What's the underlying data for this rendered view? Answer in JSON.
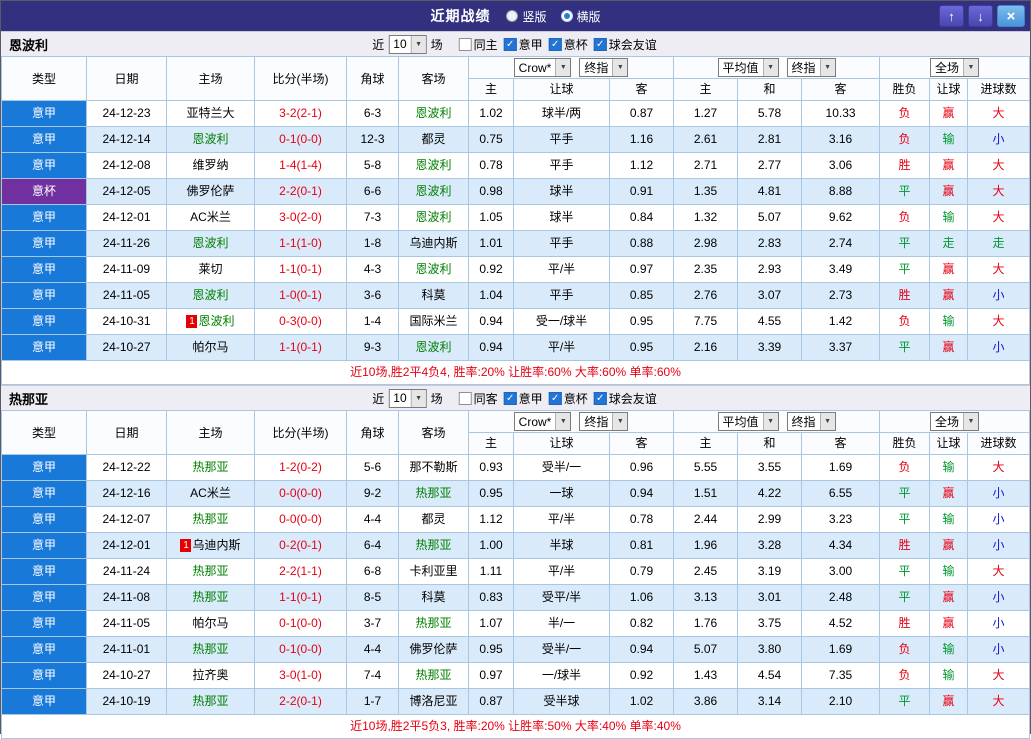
{
  "titlebar": {
    "title": "近期战绩",
    "layout_options": [
      {
        "label": "竖版",
        "selected": false
      },
      {
        "label": "横版",
        "selected": true
      }
    ]
  },
  "icons": {
    "dropdown": "▼",
    "check": "✓",
    "up": "↑",
    "down": "↓",
    "close": "×"
  },
  "colors": {
    "titlebar_bg": "#33307F",
    "serie_a_bg": "#1879D9",
    "coppa_italia_bg": "#7030A0",
    "featured_team_text": "#008000",
    "score_text": "#E60012",
    "alt_row_bg": "#D9EAFB",
    "summary_text": "#E60012"
  },
  "result_colors": {
    "胜": "red",
    "平": "green",
    "负": "red",
    "赢": "red",
    "输": "green",
    "走": "green",
    "大": "red",
    "小": "blue"
  },
  "table_header": {
    "type": "类型",
    "date": "日期",
    "home": "主场",
    "score": "比分(半场)",
    "corner": "角球",
    "away": "客场",
    "odds_select": "Crow*",
    "odds_time_select": "终指",
    "odds_home": "主",
    "odds_handicap": "让球",
    "odds_away": "客",
    "avg_select": "平均值",
    "avg_time_select": "终指",
    "avg_home": "主",
    "avg_draw": "和",
    "avg_away": "客",
    "period_select": "全场",
    "result": "胜负",
    "result_handicap": "让球",
    "result_goals": "进球数"
  },
  "sections": [
    {
      "team": "恩波利",
      "filter": {
        "near_label": "近",
        "count": "10",
        "games_label": "场",
        "checks": [
          {
            "label": "同主",
            "checked": false
          },
          {
            "label": "意甲",
            "checked": true
          },
          {
            "label": "意杯",
            "checked": true
          },
          {
            "label": "球会友谊",
            "checked": true
          }
        ]
      },
      "rows": [
        {
          "league": "意甲",
          "date": "24-12-23",
          "home": "亚特兰大",
          "score": "3-2(2-1)",
          "corner": "6-3",
          "away": "恩波利",
          "away_feat": true,
          "o1": "1.02",
          "hc": "球半/两",
          "o2": "0.87",
          "avg_h": "1.27",
          "avg_d": "5.78",
          "avg_a": "10.33",
          "result": "负",
          "handicap_result": "赢",
          "goals_result": "大"
        },
        {
          "league": "意甲",
          "date": "24-12-14",
          "home": "恩波利",
          "home_feat": true,
          "score": "0-1(0-0)",
          "corner": "12-3",
          "away": "都灵",
          "o1": "0.75",
          "hc": "平手",
          "o2": "1.16",
          "avg_h": "2.61",
          "avg_d": "2.81",
          "avg_a": "3.16",
          "result": "负",
          "handicap_result": "输",
          "goals_result": "小"
        },
        {
          "league": "意甲",
          "date": "24-12-08",
          "home": "维罗纳",
          "score": "1-4(1-4)",
          "corner": "5-8",
          "away": "恩波利",
          "away_feat": true,
          "o1": "0.78",
          "hc": "平手",
          "o2": "1.12",
          "avg_h": "2.71",
          "avg_d": "2.77",
          "avg_a": "3.06",
          "result": "胜",
          "handicap_result": "赢",
          "goals_result": "大"
        },
        {
          "league": "意杯",
          "date": "24-12-05",
          "home": "佛罗伦萨",
          "score": "2-2(0-1)",
          "corner": "6-6",
          "away": "恩波利",
          "away_feat": true,
          "o1": "0.98",
          "hc": "球半",
          "o2": "0.91",
          "avg_h": "1.35",
          "avg_d": "4.81",
          "avg_a": "8.88",
          "result": "平",
          "handicap_result": "赢",
          "goals_result": "大"
        },
        {
          "league": "意甲",
          "date": "24-12-01",
          "home": "AC米兰",
          "score": "3-0(2-0)",
          "corner": "7-3",
          "away": "恩波利",
          "away_feat": true,
          "o1": "1.05",
          "hc": "球半",
          "o2": "0.84",
          "avg_h": "1.32",
          "avg_d": "5.07",
          "avg_a": "9.62",
          "result": "负",
          "handicap_result": "输",
          "goals_result": "大"
        },
        {
          "league": "意甲",
          "date": "24-11-26",
          "home": "恩波利",
          "home_feat": true,
          "score": "1-1(1-0)",
          "corner": "1-8",
          "away": "乌迪内斯",
          "o1": "1.01",
          "hc": "平手",
          "o2": "0.88",
          "avg_h": "2.98",
          "avg_d": "2.83",
          "avg_a": "2.74",
          "result": "平",
          "handicap_result": "走",
          "goals_result": "走"
        },
        {
          "league": "意甲",
          "date": "24-11-09",
          "home": "莱切",
          "score": "1-1(0-1)",
          "corner": "4-3",
          "away": "恩波利",
          "away_feat": true,
          "o1": "0.92",
          "hc": "平/半",
          "o2": "0.97",
          "avg_h": "2.35",
          "avg_d": "2.93",
          "avg_a": "3.49",
          "result": "平",
          "handicap_result": "赢",
          "goals_result": "大"
        },
        {
          "league": "意甲",
          "date": "24-11-05",
          "home": "恩波利",
          "home_feat": true,
          "score": "1-0(0-1)",
          "corner": "3-6",
          "away": "科莫",
          "o1": "1.04",
          "hc": "平手",
          "o2": "0.85",
          "avg_h": "2.76",
          "avg_d": "3.07",
          "avg_a": "2.73",
          "result": "胜",
          "handicap_result": "赢",
          "goals_result": "小"
        },
        {
          "league": "意甲",
          "date": "24-10-31",
          "home": "恩波利",
          "home_feat": true,
          "home_card": "1",
          "score": "0-3(0-0)",
          "corner": "1-4",
          "away": "国际米兰",
          "o1": "0.94",
          "hc": "受一/球半",
          "o2": "0.95",
          "avg_h": "7.75",
          "avg_d": "4.55",
          "avg_a": "1.42",
          "result": "负",
          "handicap_result": "输",
          "goals_result": "大"
        },
        {
          "league": "意甲",
          "date": "24-10-27",
          "home": "帕尔马",
          "score": "1-1(0-1)",
          "corner": "9-3",
          "away": "恩波利",
          "away_feat": true,
          "o1": "0.94",
          "hc": "平/半",
          "o2": "0.95",
          "avg_h": "2.16",
          "avg_d": "3.39",
          "avg_a": "3.37",
          "result": "平",
          "handicap_result": "赢",
          "goals_result": "小"
        }
      ],
      "summary": "近10场,胜2平4负4, 胜率:20% 让胜率:60% 大率:60% 单率:60%"
    },
    {
      "team": "热那亚",
      "filter": {
        "near_label": "近",
        "count": "10",
        "games_label": "场",
        "checks": [
          {
            "label": "同客",
            "checked": false
          },
          {
            "label": "意甲",
            "checked": true
          },
          {
            "label": "意杯",
            "checked": true
          },
          {
            "label": "球会友谊",
            "checked": true
          }
        ]
      },
      "rows": [
        {
          "league": "意甲",
          "date": "24-12-22",
          "home": "热那亚",
          "home_feat": true,
          "score": "1-2(0-2)",
          "corner": "5-6",
          "away": "那不勒斯",
          "o1": "0.93",
          "hc": "受半/一",
          "o2": "0.96",
          "avg_h": "5.55",
          "avg_d": "3.55",
          "avg_a": "1.69",
          "result": "负",
          "handicap_result": "输",
          "goals_result": "大"
        },
        {
          "league": "意甲",
          "date": "24-12-16",
          "home": "AC米兰",
          "score": "0-0(0-0)",
          "corner": "9-2",
          "away": "热那亚",
          "away_feat": true,
          "o1": "0.95",
          "hc": "一球",
          "o2": "0.94",
          "avg_h": "1.51",
          "avg_d": "4.22",
          "avg_a": "6.55",
          "result": "平",
          "handicap_result": "赢",
          "goals_result": "小"
        },
        {
          "league": "意甲",
          "date": "24-12-07",
          "home": "热那亚",
          "home_feat": true,
          "score": "0-0(0-0)",
          "corner": "4-4",
          "away": "都灵",
          "o1": "1.12",
          "hc": "平/半",
          "o2": "0.78",
          "avg_h": "2.44",
          "avg_d": "2.99",
          "avg_a": "3.23",
          "result": "平",
          "handicap_result": "输",
          "goals_result": "小"
        },
        {
          "league": "意甲",
          "date": "24-12-01",
          "home": "乌迪内斯",
          "home_card": "1",
          "score": "0-2(0-1)",
          "corner": "6-4",
          "away": "热那亚",
          "away_feat": true,
          "o1": "1.00",
          "hc": "半球",
          "o2": "0.81",
          "avg_h": "1.96",
          "avg_d": "3.28",
          "avg_a": "4.34",
          "result": "胜",
          "handicap_result": "赢",
          "goals_result": "小"
        },
        {
          "league": "意甲",
          "date": "24-11-24",
          "home": "热那亚",
          "home_feat": true,
          "score": "2-2(1-1)",
          "corner": "6-8",
          "away": "卡利亚里",
          "o1": "1.11",
          "hc": "平/半",
          "o2": "0.79",
          "avg_h": "2.45",
          "avg_d": "3.19",
          "avg_a": "3.00",
          "result": "平",
          "handicap_result": "输",
          "goals_result": "大"
        },
        {
          "league": "意甲",
          "date": "24-11-08",
          "home": "热那亚",
          "home_feat": true,
          "score": "1-1(0-1)",
          "corner": "8-5",
          "away": "科莫",
          "o1": "0.83",
          "hc": "受平/半",
          "o2": "1.06",
          "avg_h": "3.13",
          "avg_d": "3.01",
          "avg_a": "2.48",
          "result": "平",
          "handicap_result": "赢",
          "goals_result": "小"
        },
        {
          "league": "意甲",
          "date": "24-11-05",
          "home": "帕尔马",
          "score": "0-1(0-0)",
          "corner": "3-7",
          "away": "热那亚",
          "away_feat": true,
          "o1": "1.07",
          "hc": "半/一",
          "o2": "0.82",
          "avg_h": "1.76",
          "avg_d": "3.75",
          "avg_a": "4.52",
          "result": "胜",
          "handicap_result": "赢",
          "goals_result": "小"
        },
        {
          "league": "意甲",
          "date": "24-11-01",
          "home": "热那亚",
          "home_feat": true,
          "score": "0-1(0-0)",
          "corner": "4-4",
          "away": "佛罗伦萨",
          "o1": "0.95",
          "hc": "受半/一",
          "o2": "0.94",
          "avg_h": "5.07",
          "avg_d": "3.80",
          "avg_a": "1.69",
          "result": "负",
          "handicap_result": "输",
          "goals_result": "小"
        },
        {
          "league": "意甲",
          "date": "24-10-27",
          "home": "拉齐奥",
          "score": "3-0(1-0)",
          "corner": "7-4",
          "away": "热那亚",
          "away_feat": true,
          "o1": "0.97",
          "hc": "一/球半",
          "o2": "0.92",
          "avg_h": "1.43",
          "avg_d": "4.54",
          "avg_a": "7.35",
          "result": "负",
          "handicap_result": "输",
          "goals_result": "大"
        },
        {
          "league": "意甲",
          "date": "24-10-19",
          "home": "热那亚",
          "home_feat": true,
          "score": "2-2(0-1)",
          "corner": "1-7",
          "away": "博洛尼亚",
          "o1": "0.87",
          "hc": "受半球",
          "o2": "1.02",
          "avg_h": "3.86",
          "avg_d": "3.14",
          "avg_a": "2.10",
          "result": "平",
          "handicap_result": "赢",
          "goals_result": "大"
        }
      ],
      "summary": "近10场,胜2平5负3, 胜率:20% 让胜率:50% 大率:40% 单率:40%"
    }
  ]
}
